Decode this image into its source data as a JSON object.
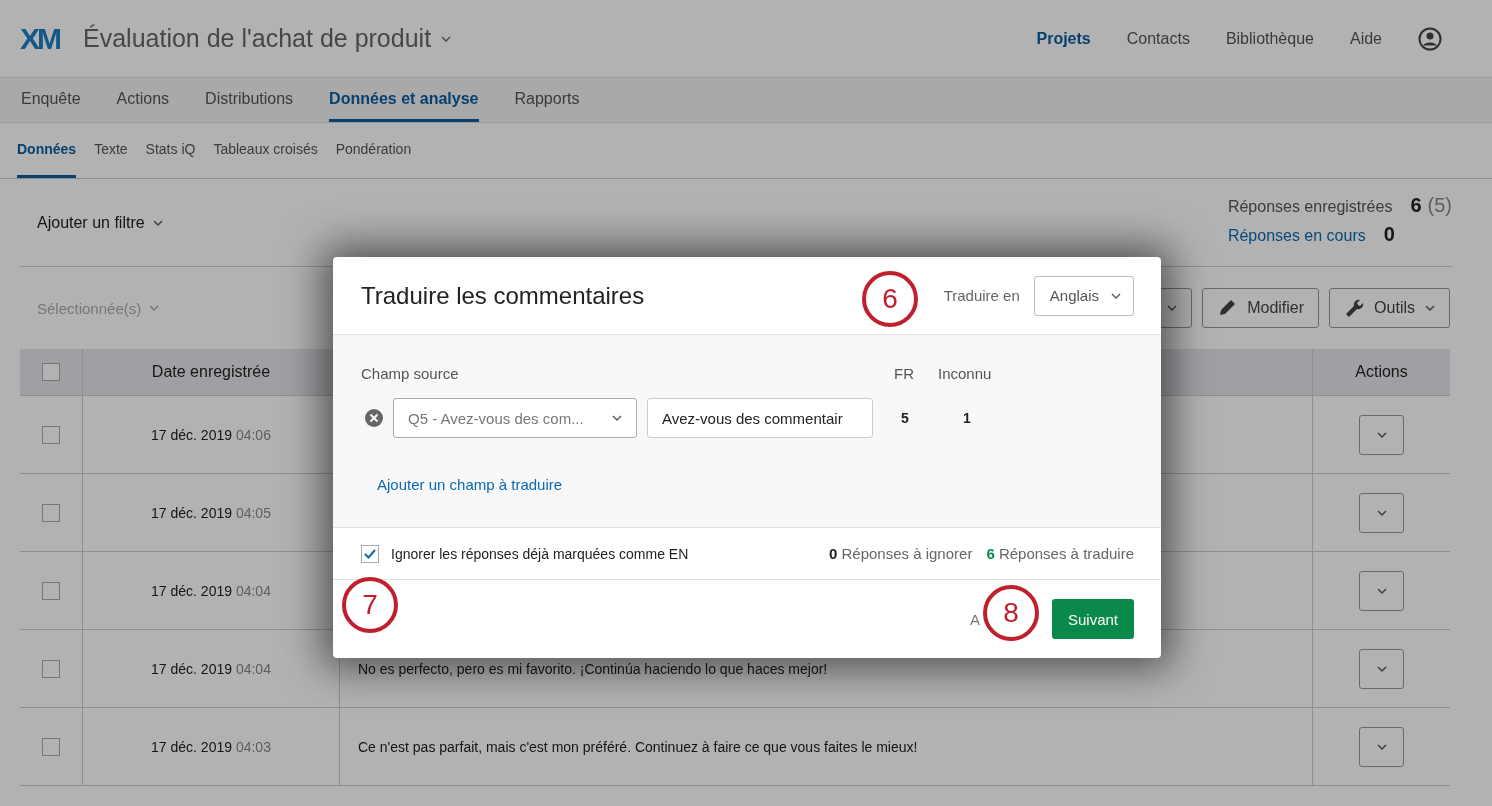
{
  "app": {
    "logo": "XM",
    "project_title": "Évaluation de l'achat de produit"
  },
  "top_nav": [
    {
      "label": "Projets",
      "selected": true
    },
    {
      "label": "Contacts",
      "selected": false
    },
    {
      "label": "Bibliothèque",
      "selected": false
    },
    {
      "label": "Aide",
      "selected": false
    }
  ],
  "tabs": [
    {
      "label": "Enquête",
      "selected": false
    },
    {
      "label": "Actions",
      "selected": false
    },
    {
      "label": "Distributions",
      "selected": false
    },
    {
      "label": "Données et analyse",
      "selected": true
    },
    {
      "label": "Rapports",
      "selected": false
    }
  ],
  "subtabs": [
    {
      "label": "Données",
      "selected": true
    },
    {
      "label": "Texte",
      "selected": false
    },
    {
      "label": "Stats iQ",
      "selected": false
    },
    {
      "label": "Tableaux croisés",
      "selected": false
    },
    {
      "label": "Pondération",
      "selected": false
    }
  ],
  "filter": {
    "label": "Ajouter un filtre"
  },
  "recorded": {
    "label": "Réponses enregistrées",
    "value": "6",
    "extra": "(5)"
  },
  "in_progress": {
    "label": "Réponses en cours",
    "value": "0"
  },
  "toolbar": {
    "selection": {
      "label": "Sélectionnée(s)",
      "disabled": true
    },
    "buttons": [
      {
        "label": "Modifier",
        "kind": "pencil"
      },
      {
        "label": "Outils",
        "kind": "wrench"
      }
    ]
  },
  "table": {
    "date_header": "Date enregistrée",
    "actions_header": "Actions",
    "all_checked": false,
    "rows": [
      {
        "date": "17 déc. 2019",
        "time": "04:06",
        "checked": false
      },
      {
        "date": "17 déc. 2019",
        "time": "04:05",
        "checked": false
      },
      {
        "date": "17 déc. 2019",
        "time": "04:04",
        "checked": false
      },
      {
        "date": "17 déc. 2019",
        "time": "04:04",
        "checked": false,
        "comment": "No es perfecto, pero es mi favorito. ¡Continúa haciendo lo que haces mejor!"
      },
      {
        "date": "17 déc. 2019",
        "time": "04:03",
        "checked": false,
        "comment": "Ce n'est pas parfait, mais c'est mon préféré. Continuez à faire ce que vous faites le mieux!"
      }
    ]
  },
  "dialog": {
    "title": "Traduire les commentaires",
    "target_label": "Traduire en",
    "target_value": "Anglais",
    "source_label": "Champ source",
    "count_columns": [
      "FR",
      "Inconnu"
    ],
    "fields": [
      {
        "source": "Q5 - Avez-vous des com...",
        "label_value": "Avez-vous des commentair",
        "counts": [
          "5",
          "1"
        ]
      }
    ],
    "add_link": "Ajouter un champ à traduire",
    "ignore": {
      "label": "Ignorer les réponses déjà marquées comme EN",
      "checked": true
    },
    "ignored_count": "0",
    "ignored_label": "Réponses à ignorer",
    "translate_count": "6",
    "translate_label": "Réponses à traduire",
    "cancel": "A",
    "next": "Suivant"
  },
  "annotations": [
    {
      "label": "6"
    },
    {
      "label": "7"
    },
    {
      "label": "8"
    }
  ]
}
